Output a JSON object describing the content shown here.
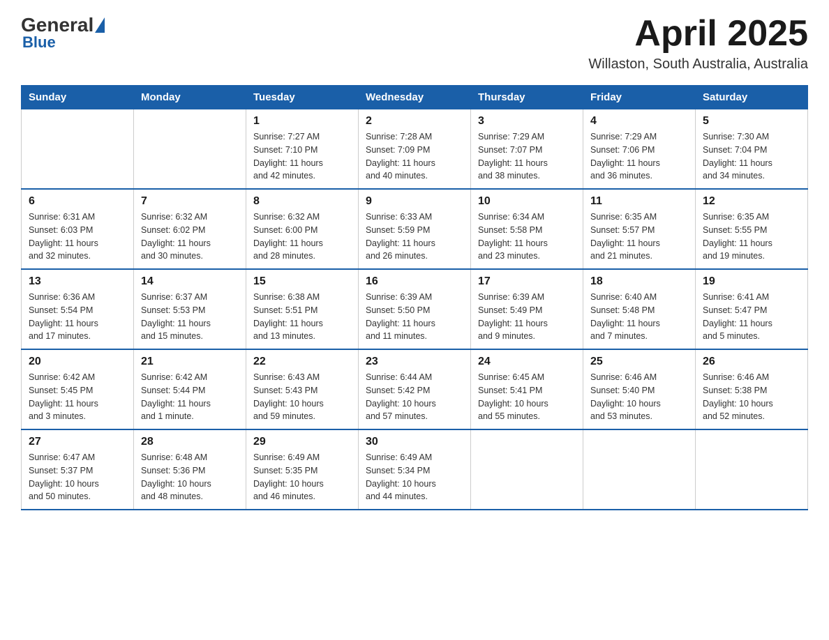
{
  "header": {
    "logo_general": "General",
    "logo_blue": "Blue",
    "month_title": "April 2025",
    "location": "Willaston, South Australia, Australia"
  },
  "days_of_week": [
    "Sunday",
    "Monday",
    "Tuesday",
    "Wednesday",
    "Thursday",
    "Friday",
    "Saturday"
  ],
  "weeks": [
    [
      {
        "day": "",
        "info": ""
      },
      {
        "day": "",
        "info": ""
      },
      {
        "day": "1",
        "info": "Sunrise: 7:27 AM\nSunset: 7:10 PM\nDaylight: 11 hours\nand 42 minutes."
      },
      {
        "day": "2",
        "info": "Sunrise: 7:28 AM\nSunset: 7:09 PM\nDaylight: 11 hours\nand 40 minutes."
      },
      {
        "day": "3",
        "info": "Sunrise: 7:29 AM\nSunset: 7:07 PM\nDaylight: 11 hours\nand 38 minutes."
      },
      {
        "day": "4",
        "info": "Sunrise: 7:29 AM\nSunset: 7:06 PM\nDaylight: 11 hours\nand 36 minutes."
      },
      {
        "day": "5",
        "info": "Sunrise: 7:30 AM\nSunset: 7:04 PM\nDaylight: 11 hours\nand 34 minutes."
      }
    ],
    [
      {
        "day": "6",
        "info": "Sunrise: 6:31 AM\nSunset: 6:03 PM\nDaylight: 11 hours\nand 32 minutes."
      },
      {
        "day": "7",
        "info": "Sunrise: 6:32 AM\nSunset: 6:02 PM\nDaylight: 11 hours\nand 30 minutes."
      },
      {
        "day": "8",
        "info": "Sunrise: 6:32 AM\nSunset: 6:00 PM\nDaylight: 11 hours\nand 28 minutes."
      },
      {
        "day": "9",
        "info": "Sunrise: 6:33 AM\nSunset: 5:59 PM\nDaylight: 11 hours\nand 26 minutes."
      },
      {
        "day": "10",
        "info": "Sunrise: 6:34 AM\nSunset: 5:58 PM\nDaylight: 11 hours\nand 23 minutes."
      },
      {
        "day": "11",
        "info": "Sunrise: 6:35 AM\nSunset: 5:57 PM\nDaylight: 11 hours\nand 21 minutes."
      },
      {
        "day": "12",
        "info": "Sunrise: 6:35 AM\nSunset: 5:55 PM\nDaylight: 11 hours\nand 19 minutes."
      }
    ],
    [
      {
        "day": "13",
        "info": "Sunrise: 6:36 AM\nSunset: 5:54 PM\nDaylight: 11 hours\nand 17 minutes."
      },
      {
        "day": "14",
        "info": "Sunrise: 6:37 AM\nSunset: 5:53 PM\nDaylight: 11 hours\nand 15 minutes."
      },
      {
        "day": "15",
        "info": "Sunrise: 6:38 AM\nSunset: 5:51 PM\nDaylight: 11 hours\nand 13 minutes."
      },
      {
        "day": "16",
        "info": "Sunrise: 6:39 AM\nSunset: 5:50 PM\nDaylight: 11 hours\nand 11 minutes."
      },
      {
        "day": "17",
        "info": "Sunrise: 6:39 AM\nSunset: 5:49 PM\nDaylight: 11 hours\nand 9 minutes."
      },
      {
        "day": "18",
        "info": "Sunrise: 6:40 AM\nSunset: 5:48 PM\nDaylight: 11 hours\nand 7 minutes."
      },
      {
        "day": "19",
        "info": "Sunrise: 6:41 AM\nSunset: 5:47 PM\nDaylight: 11 hours\nand 5 minutes."
      }
    ],
    [
      {
        "day": "20",
        "info": "Sunrise: 6:42 AM\nSunset: 5:45 PM\nDaylight: 11 hours\nand 3 minutes."
      },
      {
        "day": "21",
        "info": "Sunrise: 6:42 AM\nSunset: 5:44 PM\nDaylight: 11 hours\nand 1 minute."
      },
      {
        "day": "22",
        "info": "Sunrise: 6:43 AM\nSunset: 5:43 PM\nDaylight: 10 hours\nand 59 minutes."
      },
      {
        "day": "23",
        "info": "Sunrise: 6:44 AM\nSunset: 5:42 PM\nDaylight: 10 hours\nand 57 minutes."
      },
      {
        "day": "24",
        "info": "Sunrise: 6:45 AM\nSunset: 5:41 PM\nDaylight: 10 hours\nand 55 minutes."
      },
      {
        "day": "25",
        "info": "Sunrise: 6:46 AM\nSunset: 5:40 PM\nDaylight: 10 hours\nand 53 minutes."
      },
      {
        "day": "26",
        "info": "Sunrise: 6:46 AM\nSunset: 5:38 PM\nDaylight: 10 hours\nand 52 minutes."
      }
    ],
    [
      {
        "day": "27",
        "info": "Sunrise: 6:47 AM\nSunset: 5:37 PM\nDaylight: 10 hours\nand 50 minutes."
      },
      {
        "day": "28",
        "info": "Sunrise: 6:48 AM\nSunset: 5:36 PM\nDaylight: 10 hours\nand 48 minutes."
      },
      {
        "day": "29",
        "info": "Sunrise: 6:49 AM\nSunset: 5:35 PM\nDaylight: 10 hours\nand 46 minutes."
      },
      {
        "day": "30",
        "info": "Sunrise: 6:49 AM\nSunset: 5:34 PM\nDaylight: 10 hours\nand 44 minutes."
      },
      {
        "day": "",
        "info": ""
      },
      {
        "day": "",
        "info": ""
      },
      {
        "day": "",
        "info": ""
      }
    ]
  ]
}
